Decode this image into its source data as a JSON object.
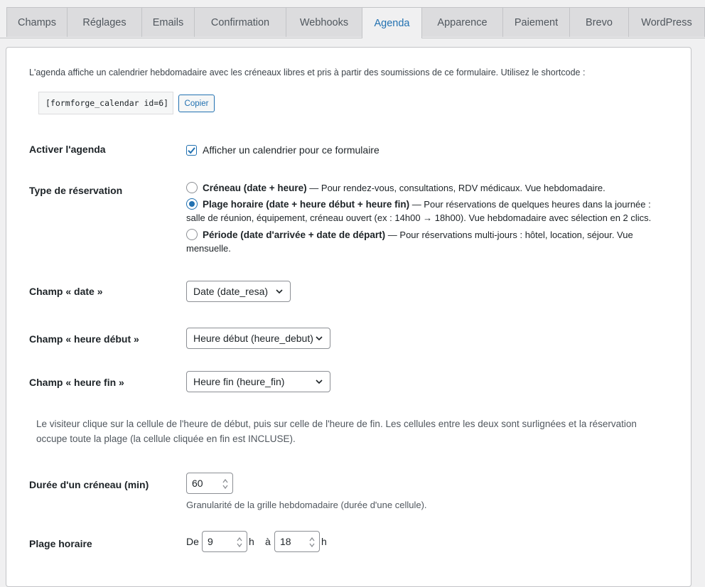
{
  "tabs": [
    {
      "label": "Champs"
    },
    {
      "label": "Réglages"
    },
    {
      "label": "Emails"
    },
    {
      "label": "Confirmation"
    },
    {
      "label": "Webhooks"
    },
    {
      "label": "Agenda"
    },
    {
      "label": "Apparence"
    },
    {
      "label": "Paiement"
    },
    {
      "label": "Brevo"
    },
    {
      "label": "WordPress"
    }
  ],
  "active_tab": "Agenda",
  "intro": "L'agenda affiche un calendrier hebdomadaire avec les créneaux libres et pris à partir des soumissions de ce formulaire. Utilisez le shortcode :",
  "shortcode": "[formforge_calendar id=6]",
  "copy_button": "Copier",
  "enable": {
    "label": "Activer l'agenda",
    "checkbox_label": "Afficher un calendrier pour ce formulaire",
    "checked": true
  },
  "reservation_type": {
    "label": "Type de réservation",
    "options": [
      {
        "title": "Créneau (date + heure)",
        "desc_line1": " — Pour rendez-vous, consultations, RDV médicaux. Vue hebdomadaire.",
        "desc_line2": "",
        "selected": false
      },
      {
        "title": "Plage horaire (date + heure début + heure fin)",
        "desc_line1": " — Pour réservations de quelques heures dans la journée :",
        "desc_line2": "salle de réunion, équipement, créneau ouvert (ex : 14h00 → 18h00). Vue hebdomadaire avec sélection en 2 clics.",
        "selected": true
      },
      {
        "title": "Période (date d'arrivée + date de départ)",
        "desc_line1": " — Pour réservations multi-jours : hôtel, location, séjour. Vue",
        "desc_line2": "mensuelle.",
        "selected": false
      }
    ]
  },
  "field_date": {
    "label": "Champ « date »",
    "value": "Date (date_resa)"
  },
  "field_start": {
    "label": "Champ « heure début »",
    "value": "Heure début (heure_debut)"
  },
  "field_end": {
    "label": "Champ « heure fin »",
    "value": "Heure fin (heure_fin)"
  },
  "click_note": {
    "line1": "Le visiteur clique sur la cellule de l'heure de début, puis sur celle de l'heure de fin. Les cellules entre les deux sont surlignées et la réservation",
    "line2": "occupe toute la plage (la cellule cliquée en fin est INCLUSE)."
  },
  "slot_duration": {
    "label": "Durée d'un créneau (min)",
    "value": "60",
    "help": "Granularité de la grille hebdomadaire (durée d'une cellule)."
  },
  "time_range": {
    "label": "Plage horaire",
    "from_label": "De",
    "from_value": "9",
    "from_unit": "h",
    "to_label": "à",
    "to_value": "18",
    "to_unit": "h"
  },
  "colors": {
    "accent": "#2271b1",
    "text": "#1d2327",
    "muted": "#50575e",
    "border": "#c3c4c7"
  }
}
